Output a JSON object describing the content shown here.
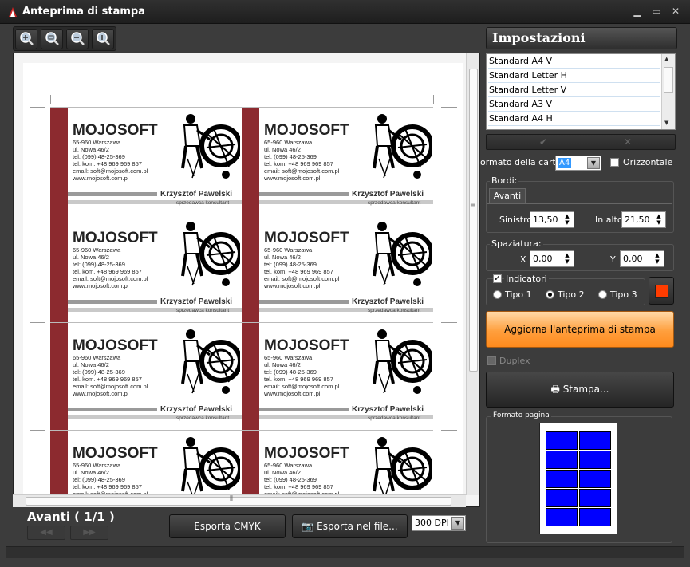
{
  "window": {
    "title": "Anteprima di stampa"
  },
  "preview": {
    "card": {
      "company": "MOJOSOFT",
      "address_lines": [
        "65-960 Warszawa",
        "ul. Nowa 46/2",
        "tel: (099) 48-25-369",
        "tel. kom. +48 969 969 857",
        "email: soft@mojosoft.com.pl",
        "www.mojosoft.com.pl"
      ],
      "person_name": "Krzysztof Pawelski",
      "person_role": "sprzedawca konsultant",
      "stripe_color": "#8c2a2f"
    }
  },
  "footer": {
    "page_info": "Avanti ( 1/1 )",
    "export_cmyk": "Esporta CMYK",
    "export_file": "Esporta nel file...",
    "dpi": "300 DPI"
  },
  "settings": {
    "title": "Impostazioni",
    "paper_list": [
      "Standard A4 V",
      "Standard Letter H",
      "Standard Letter V",
      "Standard A3 V",
      "Standard A4 H"
    ],
    "paper_format_label": "ormato della carta",
    "paper_format_value": "A4",
    "landscape_label": "Orizzontale",
    "landscape_checked": false,
    "borders": {
      "group_label": "Bordi:",
      "tab_label": "Avanti",
      "left_label": "Sinistro",
      "left_value": "13,50",
      "top_label": "In alto",
      "top_value": "21,50"
    },
    "spacing": {
      "group_label": "Spaziatura:",
      "x_label": "X",
      "x_value": "0,00",
      "y_label": "Y",
      "y_value": "0,00"
    },
    "indicators": {
      "label": "Indicatori",
      "checked": true,
      "options": [
        "Tipo 1",
        "Tipo 2",
        "Tipo 3"
      ],
      "selected": "Tipo 2",
      "color": "#ff3c00"
    },
    "refresh_button": "Aggiorna l'anteprima di stampa",
    "duplex_label": "Duplex",
    "print_button": "Stampa...",
    "page_format_label": "Formato pagina",
    "page_cell_color": "#0000ff"
  }
}
